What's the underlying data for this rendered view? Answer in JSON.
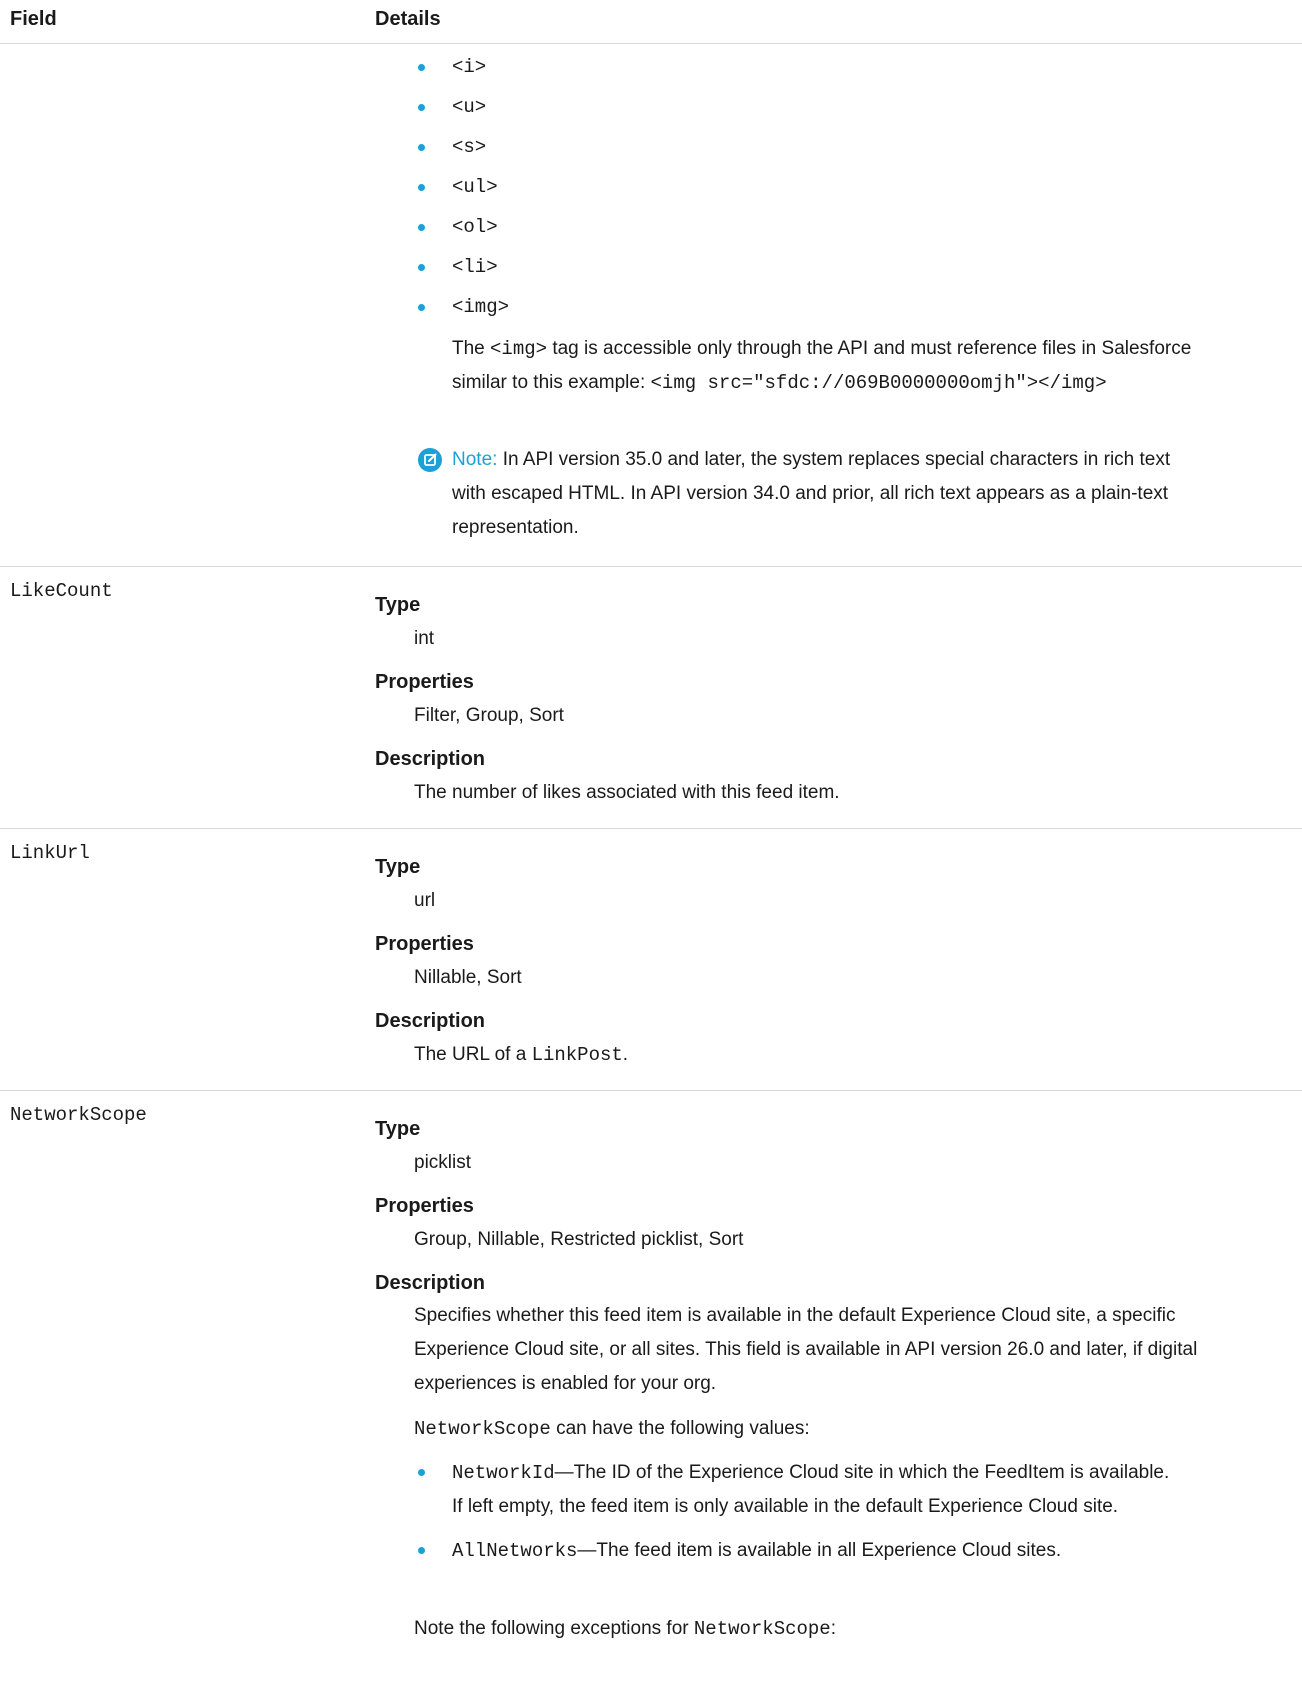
{
  "header": {
    "field": "Field",
    "details": "Details"
  },
  "top_bullets": [
    "<i>",
    "<u>",
    "<s>",
    "<ul>",
    "<ol>",
    "<li>",
    "<img>"
  ],
  "img_para": {
    "line1_pre": "The ",
    "line1_code": "<img>",
    "line1_post": " tag is accessible only through the API and must reference files in Salesforce",
    "line2_pre": "similar to this example: ",
    "line2_code": "<img src=\"sfdc://069B0000000omjh\"></img>"
  },
  "note": {
    "icon": "edit-note-icon",
    "label": "Note:",
    "line1": " In API version 35.0 and later, the system replaces special characters in rich text",
    "line2": "with escaped HTML. In API version 34.0 and prior, all rich text appears as a plain-text",
    "line3": "representation."
  },
  "like_count": {
    "name": "LikeCount",
    "type_label": "Type",
    "type_value": "int",
    "properties_label": "Properties",
    "properties_value": "Filter, Group, Sort",
    "description_label": "Description",
    "description_value": "The number of likes associated with this feed item."
  },
  "link_url": {
    "name": "LinkUrl",
    "type_label": "Type",
    "type_value": "url",
    "properties_label": "Properties",
    "properties_value": "Nillable, Sort",
    "description_label": "Description",
    "description_pre": "The URL of a ",
    "description_code": "LinkPost",
    "description_post": "."
  },
  "network_scope": {
    "name": "NetworkScope",
    "type_label": "Type",
    "type_value": "picklist",
    "properties_label": "Properties",
    "properties_value": "Group, Nillable, Restricted picklist, Sort",
    "description_label": "Description",
    "desc_line1": "Specifies whether this feed item is available in the default Experience Cloud site, a specific",
    "desc_line2": "Experience Cloud site, or all sites. This field is available in API version 26.0 and later, if digital",
    "desc_line3": "experiences is enabled for your org.",
    "values_code": "NetworkScope",
    "values_post": " can have the following values:",
    "bullet1_code": "NetworkId",
    "bullet1_line1": "—The ID of the Experience Cloud site in which the FeedItem is available.",
    "bullet1_line2": "If left empty, the feed item is only available in the default Experience Cloud site.",
    "bullet2_code": "AllNetworks",
    "bullet2_text": "—The feed item is available in all Experience Cloud sites.",
    "exceptions_pre": "Note the following exceptions for ",
    "exceptions_code": "NetworkScope",
    "exceptions_post": ":"
  },
  "colors": {
    "accent": "#1ba1d8",
    "rule": "#d8d8d8",
    "text": "#1a1a1a"
  }
}
